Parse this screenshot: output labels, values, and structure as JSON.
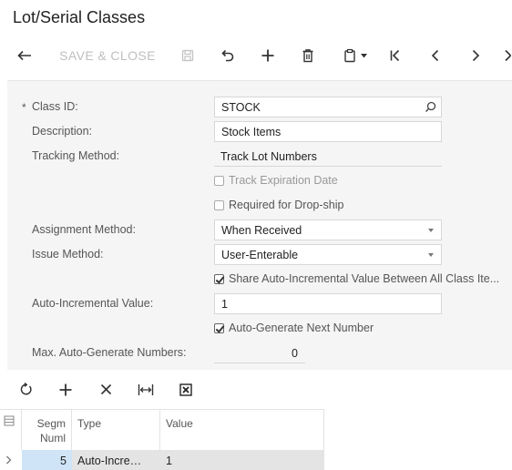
{
  "page": {
    "title": "Lot/Serial Classes"
  },
  "toolbar": {
    "save_close_label": "SAVE & CLOSE"
  },
  "form": {
    "class_id": {
      "label": "Class ID:",
      "required_mark": "*",
      "value": "STOCK"
    },
    "description": {
      "label": "Description:",
      "value": "Stock Items"
    },
    "tracking_method": {
      "label": "Tracking Method:",
      "value": "Track Lot Numbers"
    },
    "track_expiration_date": {
      "label": "Track Expiration Date",
      "checked": false
    },
    "required_for_drop_ship": {
      "label": "Required for Drop-ship",
      "checked": false
    },
    "assignment_method": {
      "label": "Assignment Method:",
      "value": "When Received"
    },
    "issue_method": {
      "label": "Issue Method:",
      "value": "User-Enterable"
    },
    "share_auto_incremental": {
      "label": "Share Auto-Incremental Value Between All Class Ite...",
      "checked": true
    },
    "auto_incremental_value": {
      "label": "Auto-Incremental Value:",
      "value": "1"
    },
    "auto_generate_next_number": {
      "label": "Auto-Generate Next Number",
      "checked": true
    },
    "max_auto_generate_numbers": {
      "label": "Max. Auto-Generate Numbers:",
      "value": "0"
    }
  },
  "grid": {
    "columns": {
      "segment": "Segm Numl",
      "type": "Type",
      "value": "Value"
    },
    "segment_line1": "Segm",
    "segment_line2": "Numl",
    "rows": [
      {
        "segment": "5",
        "type": "Auto-Incre…",
        "value": "1"
      }
    ]
  },
  "icons": {
    "back": "arrow-left-icon",
    "save": "save-icon",
    "undo": "undo-icon",
    "add": "plus-icon",
    "delete": "trash-icon",
    "copy": "clipboard-icon",
    "first": "first-record-icon",
    "prev": "chevron-left-icon",
    "next": "chevron-right-icon"
  }
}
